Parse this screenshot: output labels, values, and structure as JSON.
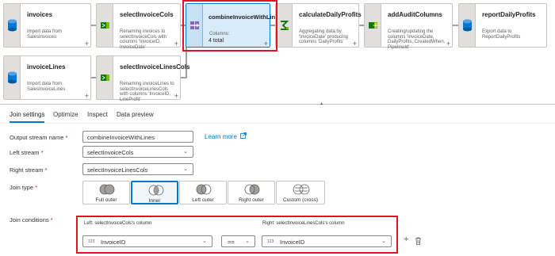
{
  "canvas": {
    "nodes": [
      {
        "title": "invoices",
        "desc": "Import data from SalesInvoices",
        "icon": "source-icon"
      },
      {
        "title": "selectInvoiceCols",
        "desc": "Renaming invoices to selectInvoiceCols with columns 'InvoiceID, InvoiceDate'",
        "icon": "select-icon"
      },
      {
        "title": "combineInvoiceWithLin...",
        "desc": "Columns:",
        "count": "4 total",
        "icon": "join-icon"
      },
      {
        "title": "calculateDailyProfits",
        "desc": "Aggregating data by 'InvoiceDate' producing columns 'DailyProfits'",
        "icon": "aggregate-icon"
      },
      {
        "title": "addAuditColumns",
        "desc": "Creating/updating the columns 'InvoiceDate, DailyProfits, CreatedWhen, PipelineId'",
        "icon": "derived-column-icon"
      },
      {
        "title": "reportDailyProfits",
        "desc": "Export data to ReportDailyProfits",
        "icon": "sink-icon"
      },
      {
        "title": "invoiceLines",
        "desc": "Import data from SalesInvoiceLines",
        "icon": "source-icon"
      },
      {
        "title": "selectInvoiceLinesCols",
        "desc": "Renaming invoiceLines to selectInvoiceLinesCols with columns 'InvoiceID, LineProfit'",
        "icon": "select-icon"
      }
    ],
    "plus": "+"
  },
  "tabs": [
    "Join settings",
    "Optimize",
    "Inspect",
    "Data preview"
  ],
  "form": {
    "output_stream_label": "Output stream name",
    "output_stream_value": "combineInvoiceWithLines",
    "learn_more": "Learn more",
    "left_stream_label": "Left stream",
    "left_stream_value": "selectInvoiceCols",
    "right_stream_label": "Right stream",
    "right_stream_value": "selectInvoiceLinesCols",
    "join_type_label": "Join type",
    "required_mark": "*",
    "join_types": [
      "Full outer",
      "Inner",
      "Left outer",
      "Right outer",
      "Custom (cross)"
    ],
    "selected_join_type": "Inner",
    "join_conditions_label": "Join conditions",
    "left_col_header": "Left: selectInvoiceCols's column",
    "right_col_header": "Right: selectInvoiceLinesCols's column",
    "left_col_value": "InvoiceID",
    "right_col_value": "InvoiceID",
    "operator": "==",
    "type_prefix": "123",
    "add_symbol": "+"
  },
  "colors": {
    "accent": "#0078d4",
    "highlight": "#e81123"
  }
}
